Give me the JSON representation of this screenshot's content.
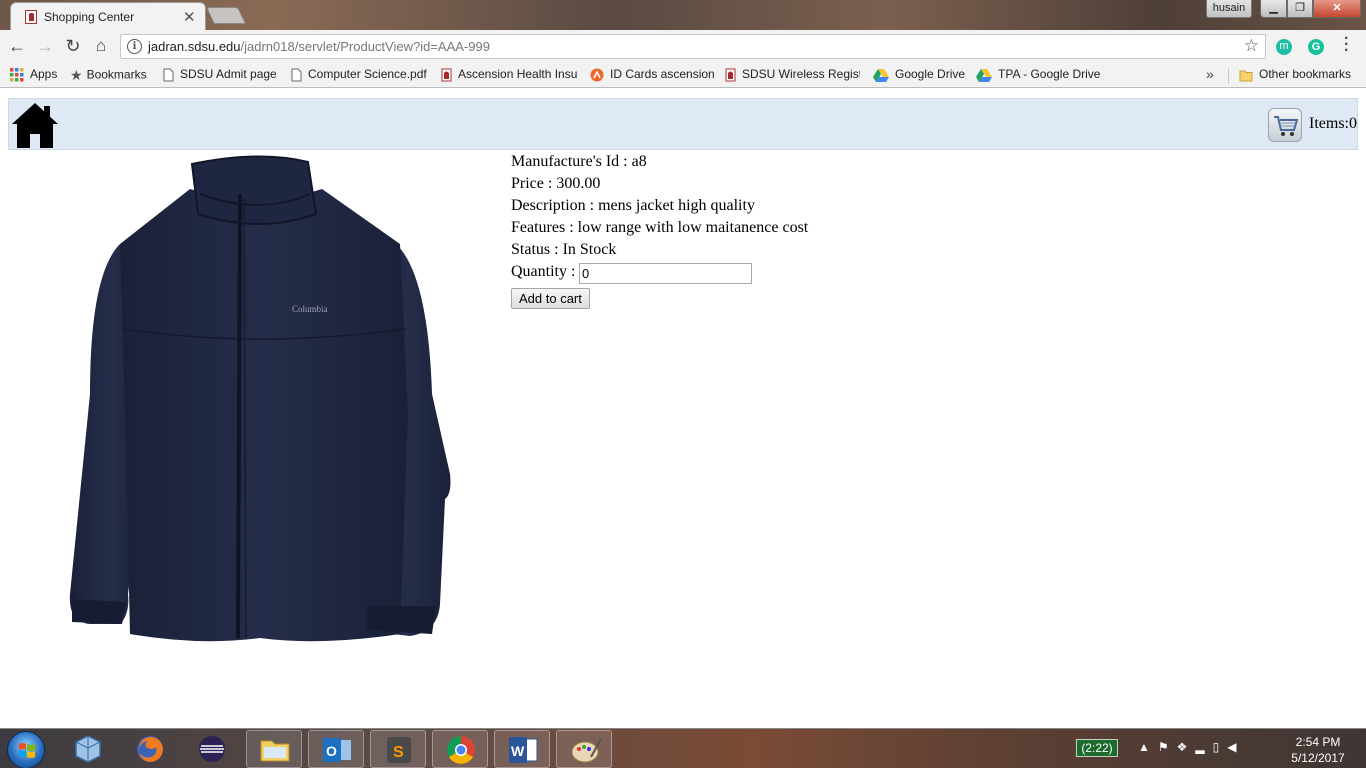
{
  "browser": {
    "tab": {
      "title": "Shopping Center"
    },
    "user": "husain",
    "url": {
      "host": "jadran.sdsu.edu",
      "path": "/jadrn018/servlet/ProductView?id=AAA-999"
    },
    "bookmarks": [
      {
        "label": "Apps",
        "icon": "apps-grid-icon"
      },
      {
        "label": "Bookmarks",
        "icon": "star-icon"
      },
      {
        "label": "SDSU Admit page",
        "icon": "page-icon"
      },
      {
        "label": "Computer Science.pdf",
        "icon": "page-icon"
      },
      {
        "label": "Ascension Health Insu",
        "icon": "sdsu-icon"
      },
      {
        "label": "ID Cards ascension",
        "icon": "ascension-icon"
      },
      {
        "label": "SDSU Wireless Registr",
        "icon": "sdsu-icon"
      },
      {
        "label": "Google Drive",
        "icon": "drive-icon"
      },
      {
        "label": "TPA - Google Drive",
        "icon": "drive-icon"
      }
    ],
    "other_bookmarks": "Other bookmarks"
  },
  "header": {
    "items_label": "Items:0"
  },
  "product": {
    "manufacturer_line": "Manufacture's Id : a8",
    "price_line": "Price : 300.00",
    "description_line": "Description : mens jacket high quality",
    "features_line": "Features : low range with low maitanence cost",
    "status_line": "Status : In Stock",
    "quantity_label": "Quantity :",
    "quantity_value": "0",
    "add_button": "Add to cart",
    "image_brand": "Columbia",
    "image_color": "#1d2540"
  },
  "taskbar": {
    "battery": "(2:22)",
    "time": "2:54 PM",
    "date": "5/12/2017"
  }
}
